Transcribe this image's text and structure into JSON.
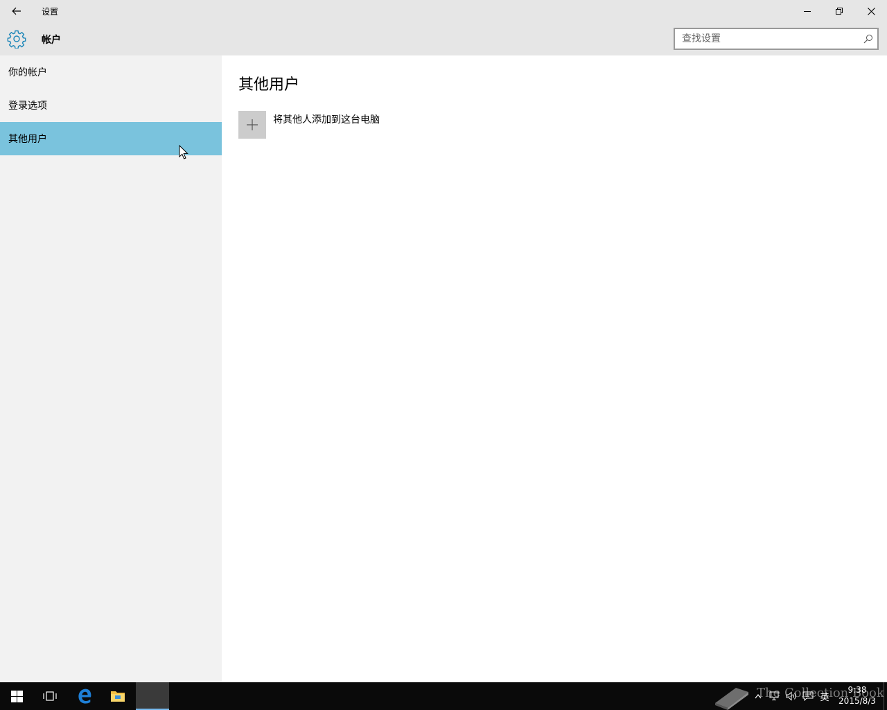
{
  "window": {
    "title": "设置"
  },
  "header": {
    "title": "帐户",
    "search_placeholder": "查找设置"
  },
  "sidebar": {
    "items": [
      {
        "label": "你的帐户",
        "selected": false
      },
      {
        "label": "登录选项",
        "selected": false
      },
      {
        "label": "其他用户",
        "selected": true
      }
    ]
  },
  "main": {
    "page_title": "其他用户",
    "add_user_label": "将其他人添加到这台电脑"
  },
  "taskbar": {
    "clock_time": "9:38",
    "clock_date": "2015/8/3",
    "ime_label": "英",
    "watermark": "The Collection Book"
  },
  "colors": {
    "chrome_bg": "#e6e6e6",
    "sidebar_bg": "#f2f2f2",
    "selected_bg": "#7ac3dd",
    "accent": "#1c86b8",
    "taskbar_bg": "#0a0a0a"
  },
  "icons": {
    "back": "arrow-left-icon",
    "settings": "gear-icon",
    "search": "search-icon",
    "add": "plus-icon",
    "start": "windows-logo-icon",
    "task_view": "task-view-icon",
    "edge": "edge-browser-icon",
    "explorer": "file-explorer-icon"
  }
}
